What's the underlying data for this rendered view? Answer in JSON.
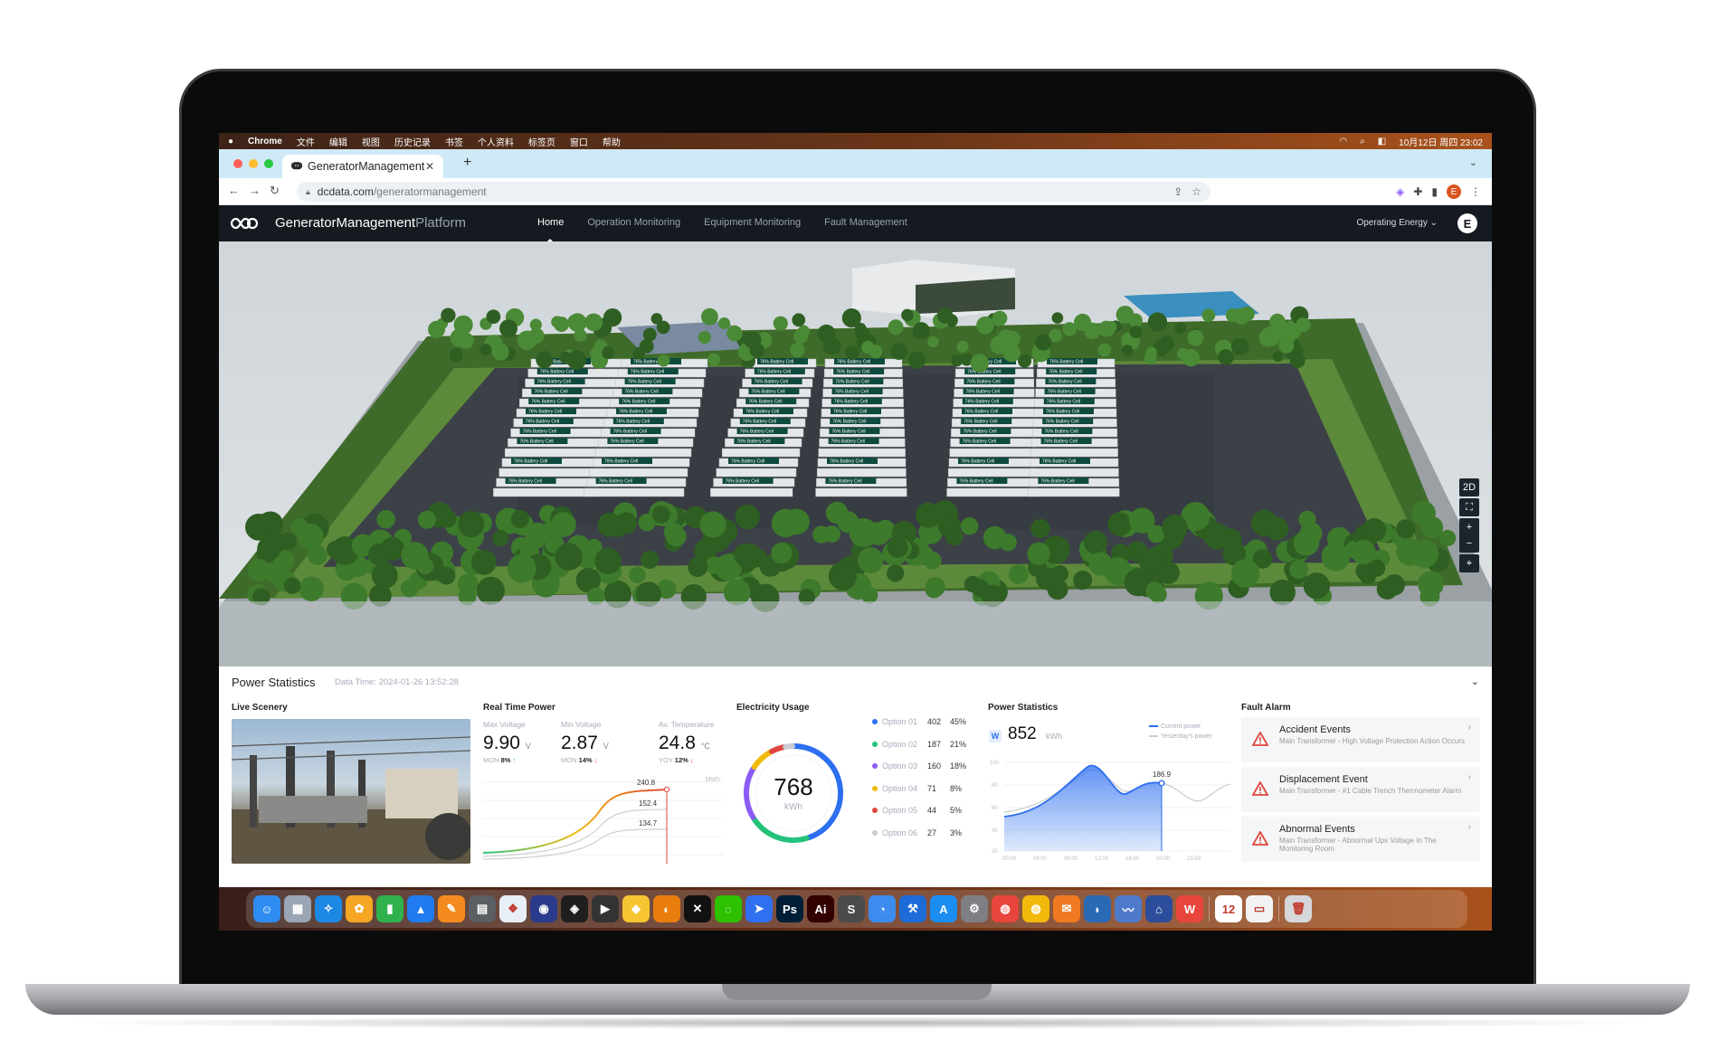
{
  "menubar": {
    "app": "Chrome",
    "items": [
      "文件",
      "编辑",
      "视图",
      "历史记录",
      "书签",
      "个人资料",
      "标签页",
      "窗口",
      "帮助"
    ],
    "clock": "10月12日 周四 23:02"
  },
  "browser": {
    "tab_title": "GeneratorManagement",
    "url_host": "dcdata.com",
    "url_path": "/generatormanagement",
    "profile_initial": "E"
  },
  "app": {
    "brand_main": "GeneratorManagement",
    "brand_suffix": "Platform",
    "nav": [
      "Home",
      "Operation Monitoring",
      "Equipment Monitoring",
      "Fault Management"
    ],
    "active_nav": "Home",
    "energy_selector": "Operating Energy",
    "user_initial": "E"
  },
  "scene": {
    "cell_label": "Battery Cell",
    "cell_prefix": "76%",
    "controls": [
      "2D",
      "⛶",
      "+",
      "−",
      "⌖"
    ]
  },
  "panel": {
    "title": "Power Statistics",
    "data_time": "Data Time: 2024-01-26 13:52:28",
    "live_scenery": {
      "title": "Live Scenery"
    },
    "real_time_power": {
      "title": "Real Time Power",
      "max_voltage": {
        "label": "Max Voltage",
        "value": "9.90",
        "unit": "V",
        "cmp_label": "MON",
        "cmp_value": "8%",
        "trend": "up"
      },
      "min_voltage": {
        "label": "Min Voltage",
        "value": "2.87",
        "unit": "V",
        "cmp_label": "MON",
        "cmp_value": "14%",
        "trend": "down"
      },
      "av_temperature": {
        "label": "Av. Temperature",
        "value": "24.8",
        "unit": "°C",
        "cmp_label": "YOY",
        "cmp_value": "12%",
        "trend": "down"
      },
      "unit_label": "MWh"
    },
    "electricity_usage": {
      "title": "Electricity Usage",
      "total": "768",
      "unit": "kWh",
      "options": [
        {
          "name": "Option 01",
          "value": "402",
          "pct": "45%",
          "color": "#2c6ff0"
        },
        {
          "name": "Option 02",
          "value": "187",
          "pct": "21%",
          "color": "#24c27a"
        },
        {
          "name": "Option 03",
          "value": "160",
          "pct": "18%",
          "color": "#8b5cf6"
        },
        {
          "name": "Option 04",
          "value": "71",
          "pct": "8%",
          "color": "#f0b90b"
        },
        {
          "name": "Option 05",
          "value": "44",
          "pct": "5%",
          "color": "#e0463c"
        },
        {
          "name": "Option 06",
          "value": "27",
          "pct": "3%",
          "color": "#c9ccd1"
        }
      ]
    },
    "power_statistics": {
      "title": "Power Statistics",
      "badge": "W",
      "value": "852",
      "unit": "kWh",
      "legend_current": "Current power",
      "legend_yesterday": "Yesterday's power",
      "marker_value": "186.9"
    },
    "fault_alarm": {
      "title": "Fault Alarm",
      "items": [
        {
          "title": "Accident Events",
          "desc": "Main Transformer - High Voltage Protection Action Occurs"
        },
        {
          "title": "Displacement Event",
          "desc": "Main Transformer - #1 Cable Trench Thermometer Alarm"
        },
        {
          "title": "Abnormal Events",
          "desc": "Main Transformer - Abnormal Ups Voltage In The Monitoring Room"
        }
      ]
    }
  },
  "dock": {
    "apps": [
      {
        "name": "Finder",
        "color": "#2f8cf0",
        "glyph": "☺"
      },
      {
        "name": "Launchpad",
        "color": "#9aa5b5",
        "glyph": "▦"
      },
      {
        "name": "Safari",
        "color": "#1e88e5",
        "glyph": "✧"
      },
      {
        "name": "Photos",
        "color": "#f5a623",
        "glyph": "✿"
      },
      {
        "name": "Numbers",
        "color": "#2fb24c",
        "glyph": "▮"
      },
      {
        "name": "Keynote",
        "color": "#1f7bef",
        "glyph": "▲"
      },
      {
        "name": "Pages",
        "color": "#f58b1f",
        "glyph": "✎"
      },
      {
        "name": "Calculator",
        "color": "#5b5e63",
        "glyph": "▤"
      },
      {
        "name": "Finder2",
        "color": "#e8eef6",
        "glyph": "❖"
      },
      {
        "name": "Firefox",
        "color": "#2b3b8c",
        "glyph": "◉"
      },
      {
        "name": "Figma",
        "color": "#1e1e1e",
        "glyph": "◈"
      },
      {
        "name": "Final Cut",
        "color": "#333",
        "glyph": "▶"
      },
      {
        "name": "Sketch",
        "color": "#f7c531",
        "glyph": "◆"
      },
      {
        "name": "Blender",
        "color": "#e87d0d",
        "glyph": "◐"
      },
      {
        "name": "CapCut",
        "color": "#111",
        "glyph": "✕"
      },
      {
        "name": "WeChat",
        "color": "#2dc100",
        "glyph": "◌"
      },
      {
        "name": "Feishu",
        "color": "#2f6ff0",
        "glyph": "➤"
      },
      {
        "name": "Ps",
        "color": "#001e36",
        "glyph": "Ps"
      },
      {
        "name": "Ai",
        "color": "#330000",
        "glyph": "Ai"
      },
      {
        "name": "Sublime",
        "color": "#4b4b4b",
        "glyph": "S"
      },
      {
        "name": "Lark",
        "color": "#3c8cf0",
        "glyph": "◔"
      },
      {
        "name": "Xcode",
        "color": "#1d6bd8",
        "glyph": "⚒"
      },
      {
        "name": "App Store",
        "color": "#1c8ef2",
        "glyph": "A"
      },
      {
        "name": "Settings",
        "color": "#7d7f84",
        "glyph": "⚙"
      },
      {
        "name": "Chrome",
        "color": "#e8453c",
        "glyph": "◍"
      },
      {
        "name": "Chrome Canary",
        "color": "#f0b90b",
        "glyph": "◍"
      },
      {
        "name": "Mail",
        "color": "#f07a22",
        "glyph": "✉"
      },
      {
        "name": "Wireshark",
        "color": "#2a6ab5",
        "glyph": "◗"
      },
      {
        "name": "Monitor",
        "color": "#4d7bc9",
        "glyph": "〰"
      },
      {
        "name": "Xcode2",
        "color": "#2c4d9c",
        "glyph": "⌂"
      },
      {
        "name": "WPS",
        "color": "#e8453c",
        "glyph": "W"
      },
      {
        "name": "Calendar",
        "color": "#ffffff",
        "glyph": "12"
      },
      {
        "name": "Files",
        "color": "#f2f2f2",
        "glyph": "▭"
      },
      {
        "name": "Trash",
        "color": "#d5d7db",
        "glyph": "🗑"
      }
    ]
  }
}
